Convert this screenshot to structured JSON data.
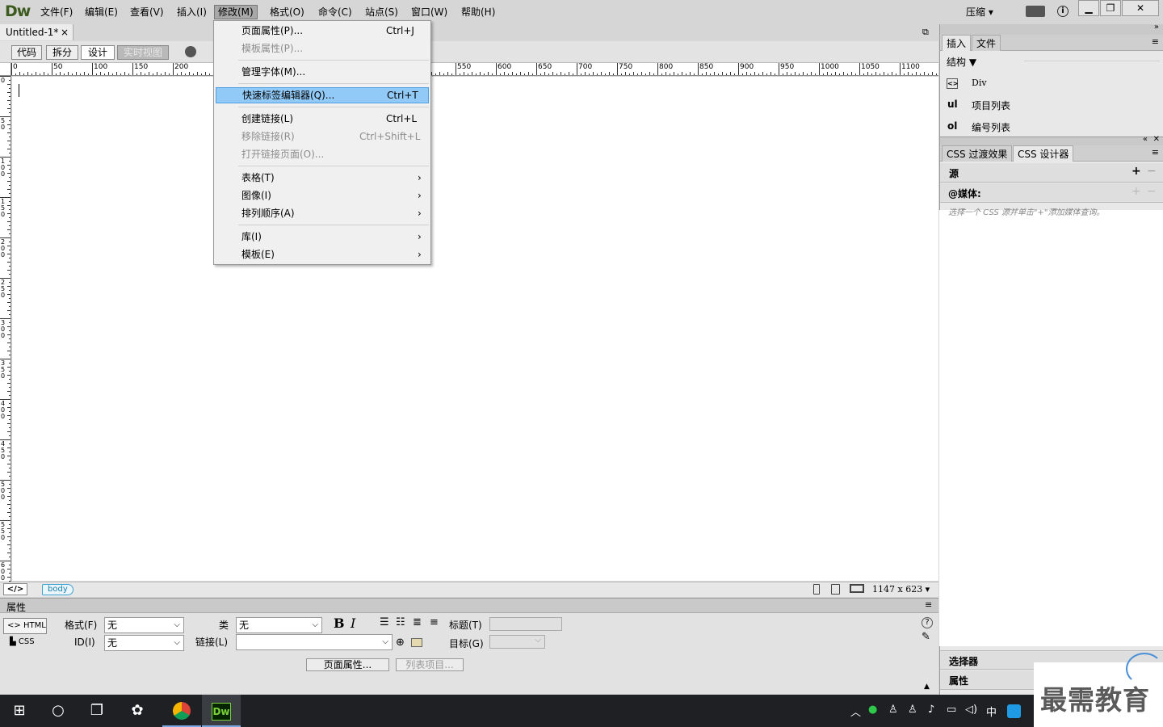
{
  "app": {
    "logo": "Dw",
    "compress": "压缩 ▾"
  },
  "menubar": [
    "文件(F)",
    "编辑(E)",
    "查看(V)",
    "插入(I)",
    "修改(M)",
    "格式(O)",
    "命令(C)",
    "站点(S)",
    "窗口(W)",
    "帮助(H)"
  ],
  "document": {
    "tab": "Untitled-1*",
    "tab_close": "×",
    "views": [
      "代码",
      "拆分",
      "设计",
      "实时视图"
    ],
    "ruler_labels": [
      "0",
      "50",
      "100",
      "150",
      "200",
      "550",
      "600",
      "650",
      "700",
      "750",
      "800",
      "850",
      "900",
      "950",
      "1000",
      "1050",
      "1100"
    ],
    "vruler_labels": [
      "0",
      "5 0",
      "1 0 0",
      "1 5 0",
      "2 0 0",
      "2 5 0",
      "3 0 0",
      "3 5 0",
      "4 0 0",
      "4 5 0",
      "5 0 0",
      "5 5 0",
      "6 0 0"
    ],
    "tag": "body",
    "size": "1147 x 623 ▾"
  },
  "dropdown": {
    "items": [
      {
        "label": "页面属性(P)...",
        "key": "Ctrl+J",
        "disabled": false
      },
      {
        "label": "模板属性(P)...",
        "key": "",
        "disabled": true
      },
      {
        "label": "管理字体(M)...",
        "key": "",
        "disabled": false
      },
      {
        "label": "快速标签编辑器(Q)...",
        "key": "Ctrl+T",
        "disabled": false,
        "highlighted": true
      },
      {
        "label": "创建链接(L)",
        "key": "Ctrl+L",
        "disabled": false
      },
      {
        "label": "移除链接(R)",
        "key": "Ctrl+Shift+L",
        "disabled": true
      },
      {
        "label": "打开链接页面(O)...",
        "key": "",
        "disabled": true
      },
      {
        "label": "表格(T)",
        "submenu": true
      },
      {
        "label": "图像(I)",
        "submenu": true
      },
      {
        "label": "排列顺序(A)",
        "submenu": true
      },
      {
        "label": "库(I)",
        "submenu": true
      },
      {
        "label": "模板(E)",
        "submenu": true
      }
    ]
  },
  "properties": {
    "title": "属性",
    "html": "HTML",
    "css": "CSS",
    "format_label": "格式(F)",
    "format_value": "无",
    "id_label": "ID(I)",
    "id_value": "无",
    "class_label": "类",
    "class_value": "无",
    "link_label": "链接(L)",
    "title_label": "标题(T)",
    "target_label": "目标(G)",
    "page_props_button": "页面属性...",
    "list_item_button": "列表项目..."
  },
  "insert_panel": {
    "tabs": [
      "插入",
      "文件"
    ],
    "category": "结构",
    "items": [
      {
        "icon": "<>",
        "label": "Div"
      },
      {
        "icon": "ul",
        "label": "项目列表"
      },
      {
        "icon": "ol",
        "label": "编号列表"
      }
    ]
  },
  "css_panel": {
    "tabs": [
      "CSS 过渡效果",
      "CSS 设计器"
    ],
    "source": "源",
    "media": "@媒体:",
    "hint": "选择一个 CSS 源并单击\"+\"添加媒体查询。",
    "selectors": "选择器",
    "properties": "属性"
  },
  "taskbar": {
    "ime": "中"
  },
  "watermark": "最需教育"
}
